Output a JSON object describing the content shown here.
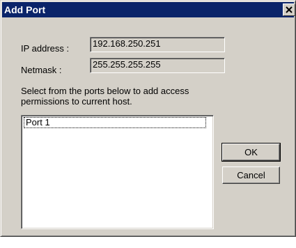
{
  "window": {
    "title": "Add Port",
    "close_glyph": "×",
    "title_bar_color": "#0a246a"
  },
  "fields": {
    "ip_label": "IP address :",
    "ip_value": "192.168.250.251",
    "netmask_label": "Netmask :",
    "netmask_value": "255.255.255.255"
  },
  "instruction": "Select from the ports below to add access permissions to current host.",
  "ports": {
    "items": [
      {
        "label": "Port 1",
        "focused": true
      }
    ]
  },
  "buttons": {
    "ok_label": "OK",
    "cancel_label": "Cancel"
  }
}
